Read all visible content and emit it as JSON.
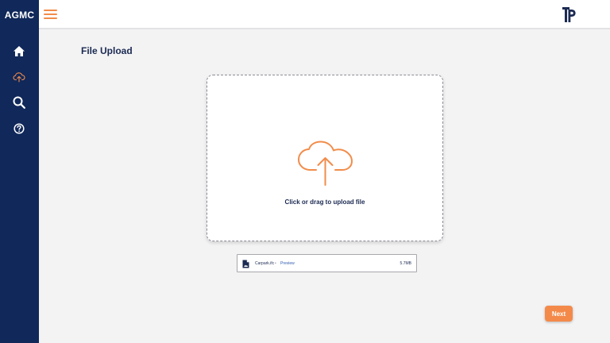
{
  "app": {
    "brand": "AGMC"
  },
  "colors": {
    "sidebar": "#10285a",
    "accent": "#f48a4a",
    "title": "#1b2a52"
  },
  "sidebar": {
    "items": [
      {
        "name": "home",
        "icon": "home-icon",
        "active": false
      },
      {
        "name": "upload",
        "icon": "cloud-upload-icon",
        "active": true
      },
      {
        "name": "search",
        "icon": "search-icon",
        "active": false
      },
      {
        "name": "help",
        "icon": "help-circle-icon",
        "active": false
      }
    ]
  },
  "header": {
    "menu_icon": "hamburger-icon",
    "logo_icon": "tp-logo-icon"
  },
  "page": {
    "title": "File Upload"
  },
  "dropzone": {
    "icon": "cloud-upload-icon",
    "text": "Click or drag to upload file"
  },
  "file": {
    "name": "Carpark.ifc",
    "separator": "•",
    "preview_label": "Preview",
    "size": "5.7MB"
  },
  "actions": {
    "next_label": "Next"
  }
}
